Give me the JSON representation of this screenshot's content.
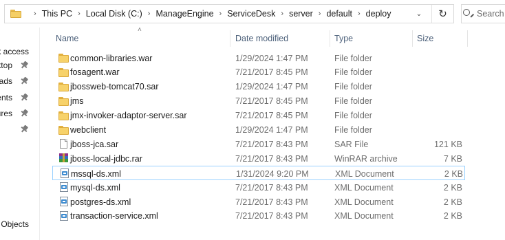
{
  "address": {
    "crumbs": [
      "This PC",
      "Local Disk (C:)",
      "ManageEngine",
      "ServiceDesk",
      "server",
      "default",
      "deploy"
    ],
    "chevron": "›",
    "dropdown_icon": "chevron-down-icon",
    "refresh_icon": "refresh-icon"
  },
  "search": {
    "placeholder": "Search deploy"
  },
  "nav": {
    "items": [
      {
        "label": "Quick access",
        "pinned": false
      },
      {
        "label": "Desktop",
        "pinned": true
      },
      {
        "label": "Downloads",
        "pinned": true
      },
      {
        "label": "Documents",
        "pinned": true
      },
      {
        "label": "Pictures",
        "pinned": true
      },
      {
        "label": "",
        "pinned": true
      },
      {
        "label": "Objects",
        "pinned": false
      }
    ]
  },
  "columns": {
    "name": "Name",
    "date": "Date modified",
    "type": "Type",
    "size": "Size"
  },
  "files": [
    {
      "icon": "folder",
      "name": "common-libraries.war",
      "date": "1/29/2024 1:47 PM",
      "type": "File folder",
      "size": ""
    },
    {
      "icon": "folder",
      "name": "fosagent.war",
      "date": "7/21/2017 8:45 PM",
      "type": "File folder",
      "size": ""
    },
    {
      "icon": "folder",
      "name": "jbossweb-tomcat70.sar",
      "date": "1/29/2024 1:47 PM",
      "type": "File folder",
      "size": ""
    },
    {
      "icon": "folder",
      "name": "jms",
      "date": "7/21/2017 8:45 PM",
      "type": "File folder",
      "size": ""
    },
    {
      "icon": "folder",
      "name": "jmx-invoker-adaptor-server.sar",
      "date": "7/21/2017 8:45 PM",
      "type": "File folder",
      "size": ""
    },
    {
      "icon": "folder",
      "name": "webclient",
      "date": "1/29/2024 1:47 PM",
      "type": "File folder",
      "size": ""
    },
    {
      "icon": "file",
      "name": "jboss-jca.sar",
      "date": "7/21/2017 8:43 PM",
      "type": "SAR File",
      "size": "121 KB"
    },
    {
      "icon": "rar",
      "name": "jboss-local-jdbc.rar",
      "date": "7/21/2017 8:43 PM",
      "type": "WinRAR archive",
      "size": "7 KB"
    },
    {
      "icon": "xml",
      "name": "mssql-ds.xml",
      "date": "1/31/2024 9:20 PM",
      "type": "XML Document",
      "size": "2 KB",
      "selected": true
    },
    {
      "icon": "xml",
      "name": "mysql-ds.xml",
      "date": "7/21/2017 8:43 PM",
      "type": "XML Document",
      "size": "2 KB"
    },
    {
      "icon": "xml",
      "name": "postgres-ds.xml",
      "date": "7/21/2017 8:43 PM",
      "type": "XML Document",
      "size": "2 KB"
    },
    {
      "icon": "xml",
      "name": "transaction-service.xml",
      "date": "7/21/2017 8:43 PM",
      "type": "XML Document",
      "size": "2 KB"
    }
  ],
  "colors": {
    "header_text": "#4c607a",
    "selection_border": "#99d1ff",
    "folder": "#f7d26a"
  }
}
